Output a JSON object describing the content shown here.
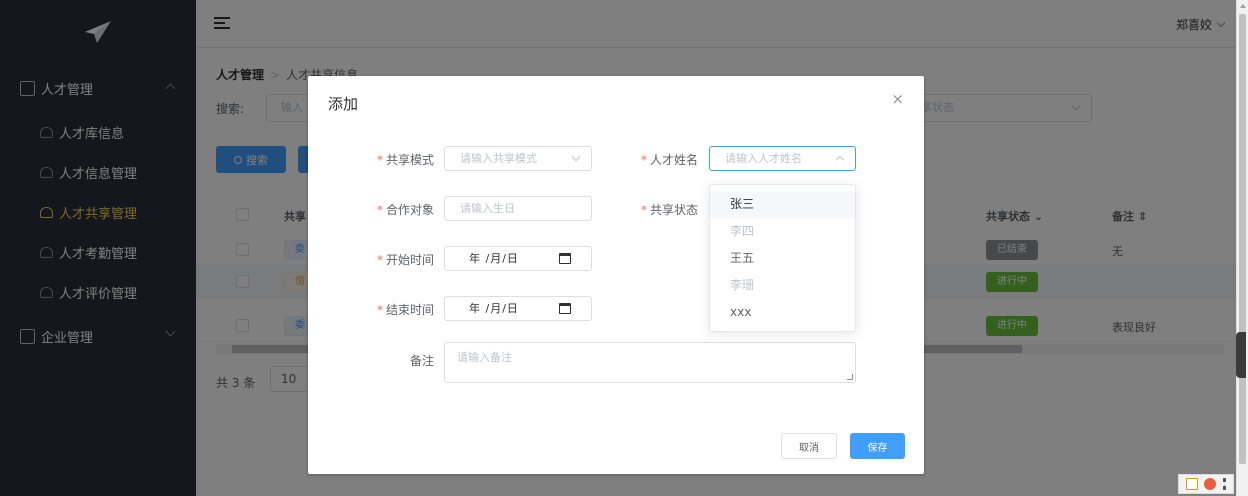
{
  "header": {
    "user_name": "郑喜姣"
  },
  "sidebar": {
    "groups": [
      {
        "label": "人才管理",
        "items": [
          {
            "label": "人才库信息"
          },
          {
            "label": "人才信息管理"
          },
          {
            "label": "人才共享管理",
            "active": true
          },
          {
            "label": "人才考勤管理"
          },
          {
            "label": "人才评价管理"
          }
        ]
      },
      {
        "label": "企业管理"
      }
    ]
  },
  "main": {
    "breadcrumb": {
      "root": "人才管理",
      "current": "人才共享信息"
    },
    "search_label": "搜索:",
    "search_placeholder": "输入",
    "status_placeholder": "享状态",
    "search_button": "搜索",
    "table": {
      "headers": [
        "共享",
        "共享状态",
        "备注"
      ],
      "rows": [
        {
          "tag": "委",
          "status": "已结束",
          "note": "无"
        },
        {
          "tag": "借",
          "status": "进行中",
          "note": ""
        },
        {
          "tag": "委",
          "status": "进行中",
          "note": "表现良好"
        }
      ]
    },
    "total": "共 3 条",
    "page_size": "10"
  },
  "dialog": {
    "title": "添加",
    "close": "×",
    "fields": {
      "share_mode": {
        "label": "共享模式",
        "placeholder": "请输入共享模式"
      },
      "talent_name": {
        "label": "人才姓名",
        "placeholder": "请输入人才姓名"
      },
      "partner": {
        "label": "合作对象",
        "placeholder": "请输入生日"
      },
      "share_status": {
        "label": "共享状态"
      },
      "start_time": {
        "label": "开始时间",
        "value": "年 /月/日"
      },
      "end_time": {
        "label": "结束时间",
        "value": "年 /月/日"
      },
      "note": {
        "label": "备注",
        "placeholder": "请输入备注"
      }
    },
    "cancel": "取消",
    "save": "保存"
  },
  "dropdown": {
    "options": [
      {
        "label": "张三",
        "state": "hover"
      },
      {
        "label": "李四",
        "state": "disabled"
      },
      {
        "label": "王五",
        "state": "normal"
      },
      {
        "label": "李珊",
        "state": "disabled"
      },
      {
        "label": "xxx",
        "state": "normal"
      }
    ]
  },
  "colors": {
    "primary": "#409eff",
    "sidebar_bg": "#28313d",
    "active_menu": "#ffd04b",
    "success": "#67c23a",
    "required": "#f56c6c"
  }
}
